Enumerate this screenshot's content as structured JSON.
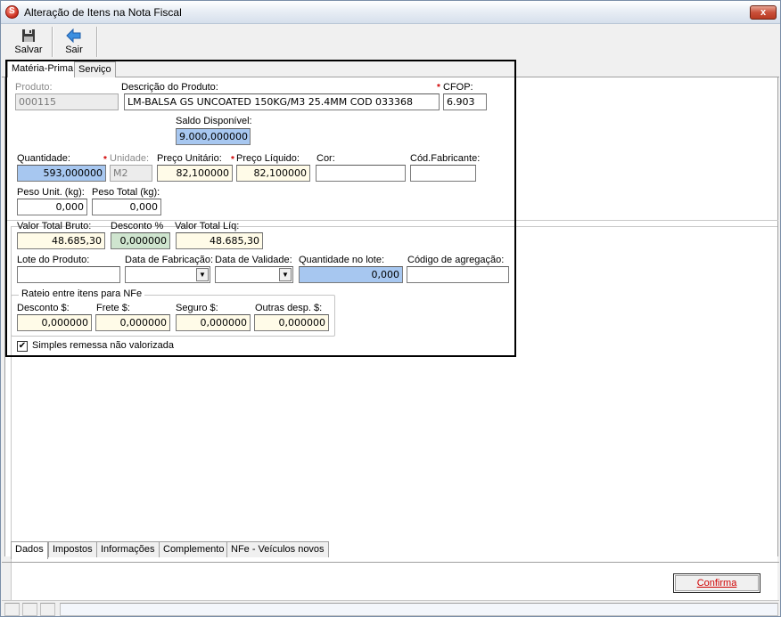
{
  "window": {
    "title": "Alteração de Itens na Nota Fiscal",
    "close_label": "x"
  },
  "toolbar": {
    "save_label": "Salvar",
    "exit_label": "Sair"
  },
  "top_tabs": [
    "Matéria-Prima",
    "Serviço"
  ],
  "bottom_tabs": [
    "Dados",
    "Impostos",
    "Informações",
    "Complemento",
    "NFe - Veículos novos"
  ],
  "product": {
    "produto_label": "Produto:",
    "produto_value": "000115",
    "descricao_label": "Descrição do Produto:",
    "descricao_value": "LM-BALSA GS UNCOATED 150KG/M3 25.4MM COD 033368",
    "cfop_label": "CFOP:",
    "cfop_value": "6.903",
    "saldo_label": "Saldo Disponível:",
    "saldo_value": "9.000,000000"
  },
  "dados": {
    "quantidade_label": "Quantidade:",
    "quantidade_value": "593,000000",
    "unidade_label": "Unidade:",
    "unidade_value": "M2",
    "preco_unit_label": "Preço Unitário:",
    "preco_unit_value": "82,100000",
    "preco_liq_label": "Preço Líquido:",
    "preco_liq_value": "82,100000",
    "cor_label": "Cor:",
    "cor_value": "",
    "cod_fab_label": "Cód.Fabricante:",
    "cod_fab_value": "",
    "peso_unit_label": "Peso Unit. (kg):",
    "peso_unit_value": "0,000",
    "peso_total_label": "Peso Total (kg):",
    "peso_total_value": "0,000",
    "valor_bruto_label": "Valor Total Bruto:",
    "valor_bruto_value": "48.685,30",
    "desconto_pct_label": "Desconto %",
    "desconto_pct_value": "0,000000",
    "valor_liq_label": "Valor Total Líq:",
    "valor_liq_value": "48.685,30",
    "lote_label": "Lote do Produto:",
    "lote_value": "",
    "data_fab_label": "Data de Fabricação:",
    "data_fab_value": "",
    "data_val_label": "Data de Validade:",
    "data_val_value": "",
    "qtd_lote_label": "Quantidade no lote:",
    "qtd_lote_value": "0,000",
    "cod_agreg_label": "Código de agregação:",
    "cod_agreg_value": ""
  },
  "rateio": {
    "title": "Rateio entre itens para NFe",
    "desconto_label": "Desconto $:",
    "desconto_value": "0,000000",
    "frete_label": "Frete $:",
    "frete_value": "0,000000",
    "seguro_label": "Seguro $:",
    "seguro_value": "0,000000",
    "outras_label": "Outras desp. $:",
    "outras_value": "0,000000"
  },
  "simples_remessa": {
    "label": "Simples remessa não valorizada",
    "checked": true
  },
  "footer": {
    "confirma_label": "Confirma"
  },
  "colors": {
    "highlight_blue": "#a7c7f0",
    "readonly_yellow": "#fffbe8",
    "discount_green": "#cfe5cf",
    "required_red": "#d00000"
  }
}
